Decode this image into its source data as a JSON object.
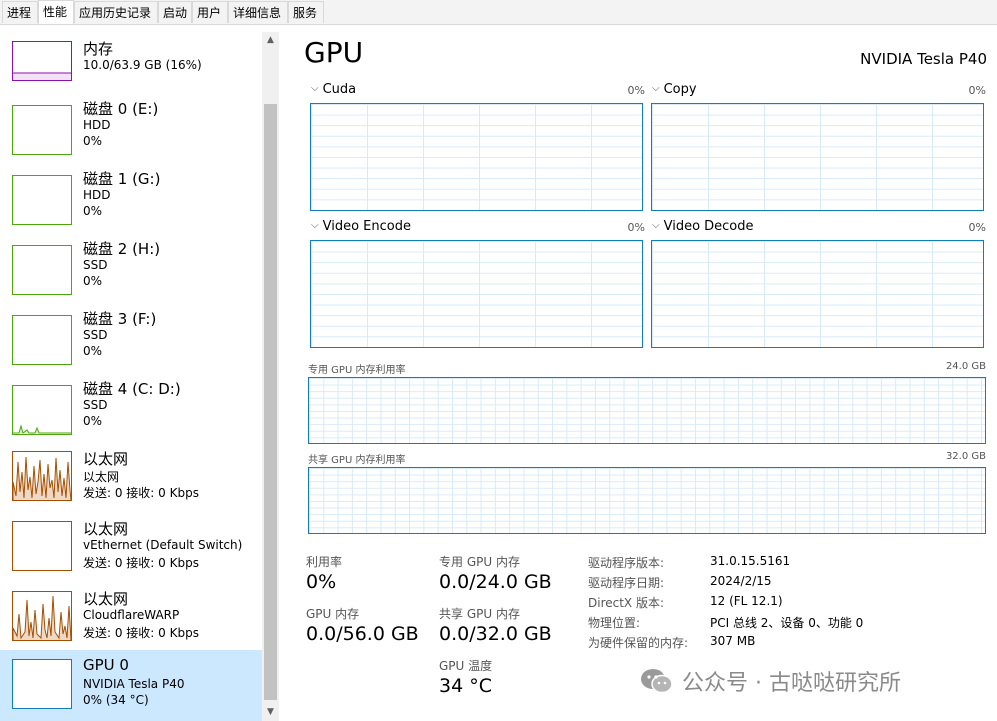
{
  "tabs": [
    "进程",
    "性能",
    "应用历史记录",
    "启动",
    "用户",
    "详细信息",
    "服务"
  ],
  "sidebar": {
    "items": [
      {
        "title": "内存",
        "sub1": "10.0/63.9 GB (16%)",
        "sub2": ""
      },
      {
        "title": "磁盘 0 (E:)",
        "sub1": "HDD",
        "sub2": "0%"
      },
      {
        "title": "磁盘 1 (G:)",
        "sub1": "HDD",
        "sub2": "0%"
      },
      {
        "title": "磁盘 2 (H:)",
        "sub1": "SSD",
        "sub2": "0%"
      },
      {
        "title": "磁盘 3 (F:)",
        "sub1": "SSD",
        "sub2": "0%"
      },
      {
        "title": "磁盘 4 (C: D:)",
        "sub1": "SSD",
        "sub2": "0%"
      },
      {
        "title": "以太网",
        "sub1": "以太网",
        "sub2": "发送: 0 接收: 0 Kbps"
      },
      {
        "title": "以太网",
        "sub1": "vEthernet (Default Switch)",
        "sub2": "发送: 0 接收: 0 Kbps"
      },
      {
        "title": "以太网",
        "sub1": "CloudflareWARP",
        "sub2": "发送: 0 接收: 0 Kbps"
      },
      {
        "title": "GPU 0",
        "sub1": "NVIDIA Tesla P40",
        "sub2": "0% (34 °C)"
      }
    ]
  },
  "main": {
    "title": "GPU",
    "device_name": "NVIDIA Tesla P40",
    "engines": [
      {
        "label": "Cuda",
        "pct": "0%"
      },
      {
        "label": "Copy",
        "pct": "0%"
      },
      {
        "label": "Video Encode",
        "pct": "0%"
      },
      {
        "label": "Video Decode",
        "pct": "0%"
      }
    ],
    "dedicated_mem": {
      "label": "专用 GPU 内存利用率",
      "max": "24.0 GB"
    },
    "shared_mem": {
      "label": "共享 GPU 内存利用率",
      "max": "32.0 GB"
    }
  },
  "stats": {
    "utilization": {
      "label": "利用率",
      "value": "0%"
    },
    "gpu_memory": {
      "label": "GPU 内存",
      "value": "0.0/56.0 GB"
    },
    "dedicated": {
      "label": "专用 GPU 内存",
      "value": "0.0/24.0 GB"
    },
    "shared": {
      "label": "共享 GPU 内存",
      "value": "0.0/32.0 GB"
    },
    "temperature": {
      "label": "GPU 温度",
      "value": "34 °C"
    }
  },
  "details": [
    {
      "key": "驱动程序版本:",
      "value": "31.0.15.5161"
    },
    {
      "key": "驱动程序日期:",
      "value": "2024/2/15"
    },
    {
      "key": "DirectX 版本:",
      "value": "12 (FL 12.1)"
    },
    {
      "key": "物理位置:",
      "value": "PCI 总线 2、设备 0、功能 0"
    },
    {
      "key": "为硬件保留的内存:",
      "value": "307 MB"
    }
  ],
  "watermark": "公众号 · 古哒哒研究所",
  "colors": {
    "memory": "#8b12ae",
    "disk": "#4da60c",
    "ethernet": "#a74f01",
    "gpu": "#117dbb",
    "selected_bg": "#cce8ff"
  }
}
